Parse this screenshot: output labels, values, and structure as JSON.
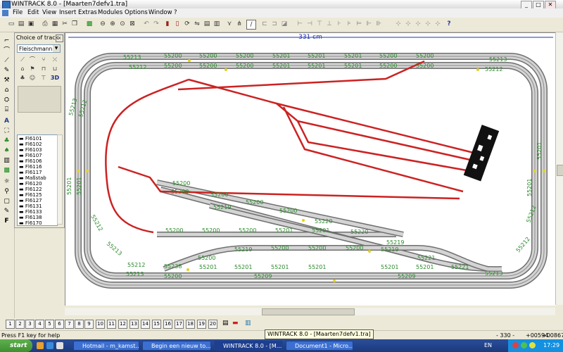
{
  "window": {
    "title": "WINTRACK 8.0 - [Maarten7defv1.tra]",
    "min": "_",
    "max": "□",
    "close": "✕"
  },
  "menu": [
    "File",
    "Edit",
    "View",
    "Insert",
    "Extras",
    "Modules",
    "Options",
    "Window",
    "?"
  ],
  "toolbar_icons": [
    "new-icon",
    "open-icon",
    "save-icon",
    "print-icon",
    "print-preview-icon",
    "cut-icon",
    "copy-icon",
    "paste-icon",
    "screen-icon",
    "zoom-out-icon",
    "zoom-in-icon",
    "zoom-fit-icon",
    "zoom-window-icon",
    "undo-icon",
    "redo-icon",
    "select-icon",
    "delete-icon",
    "rotate-icon",
    "mirror-icon",
    "draw-icon",
    "align-icon",
    "connect-icon",
    "section-icon",
    "help-icon"
  ],
  "choice_panel": {
    "title": "Choice of track",
    "manufacturer": "Fleischmann Pi",
    "items": [
      "Fl6101",
      "Fl6102",
      "Fl6103",
      "Fl6107",
      "Fl6106",
      "Fl6116",
      "Fl6117",
      "Maßstab",
      "Fl6120",
      "Fl6122",
      "Fl6125",
      "Fl6127",
      "Fl6131",
      "Fl6133",
      "Fl6138",
      "Fl6170"
    ],
    "btn_3d": "3D"
  },
  "ruler_label": "331 cm",
  "track_labels": {
    "outer_top": [
      "55213",
      "55200",
      "55200",
      "55200",
      "55201",
      "55201",
      "55201",
      "55200",
      "55200",
      "55213"
    ],
    "inner_top": [
      "55212",
      "55200",
      "55200",
      "55200",
      "55201",
      "55201",
      "55201",
      "55200",
      "55200",
      "55212"
    ],
    "left_side": [
      "55213",
      "55212",
      "55201",
      "55201",
      "55212",
      "55213"
    ],
    "right_side": [
      "55201",
      "55201",
      "55212",
      "55212"
    ],
    "middle": [
      "55200",
      "55200",
      "55200",
      "55201",
      "55201",
      "55220",
      "55220",
      "55200",
      "55200",
      "55200",
      "55200",
      "55200",
      "55219",
      "55219"
    ],
    "lower_inner": [
      "55200",
      "55219",
      "55200",
      "55200",
      "55200",
      "55219",
      "55221",
      "55212"
    ],
    "bottom_inner": [
      "55238",
      "55201",
      "55201",
      "55201",
      "55201",
      "55201",
      "55201",
      "55221"
    ],
    "bottom_outer": [
      "55213",
      "55200",
      "55209",
      "55209",
      "55213"
    ]
  },
  "layer_tabs": [
    "1",
    "2",
    "3",
    "4",
    "5",
    "6",
    "7",
    "8",
    "9",
    "10",
    "11",
    "12",
    "13",
    "14",
    "15",
    "16",
    "17",
    "18",
    "19",
    "20"
  ],
  "status": {
    "help": "Press F1 key for help",
    "tooltip": "WINTRACK 8.0 - [Maarten7defv1.tra]",
    "scale": "- 330 -",
    "x": "+00594",
    "y": "+00867"
  },
  "taskbar": {
    "start": "start",
    "tasks": [
      "Hotmail - m_kamst...",
      "Begin een nieuw to...",
      "WINTRACK 8.0 - [M...",
      "Document1 - Micro..."
    ],
    "lang": "EN",
    "clock": "17:29"
  },
  "colors": {
    "track_rail": "#6f6f6f",
    "track_bed": "#d4d4d4",
    "label": "#2a8a2a",
    "route": "#cc2222",
    "ruler": "#2233aa"
  }
}
